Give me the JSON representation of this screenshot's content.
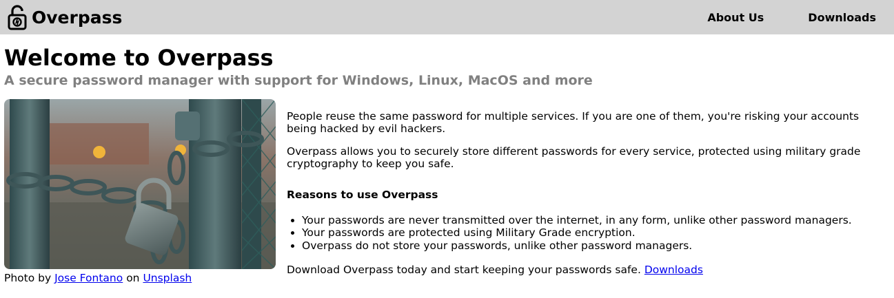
{
  "navbar": {
    "brand": "Overpass",
    "links": [
      "About Us",
      "Downloads"
    ],
    "background": "#d3d3d3"
  },
  "hero": {
    "title": "Welcome to Overpass",
    "subtitle": "A secure password manager with support for Windows, Linux, MacOS and more"
  },
  "photo": {
    "credit_prefix": "Photo by",
    "author": "Jose Fontano",
    "credit_middle": "on",
    "source": "Unsplash"
  },
  "body": {
    "intro": "People reuse the same password for multiple services. If you are one of them, you're risking your accounts being hacked by evil hackers.",
    "description": "Overpass allows you to securely store different passwords for every service, protected using military grade cryptography to keep you safe.",
    "reasons_heading": "Reasons to use Overpass",
    "reasons": [
      "Your passwords are never transmitted over the internet, in any form, unlike other password managers.",
      "Your passwords are protected using Military Grade encryption.",
      "Overpass do not store your passwords, unlike other password managers."
    ],
    "cta_text": "Download Overpass today and start keeping your passwords safe.",
    "cta_link": "Downloads"
  },
  "colors": {
    "link": "#0000ee",
    "subtitle": "#808080"
  }
}
